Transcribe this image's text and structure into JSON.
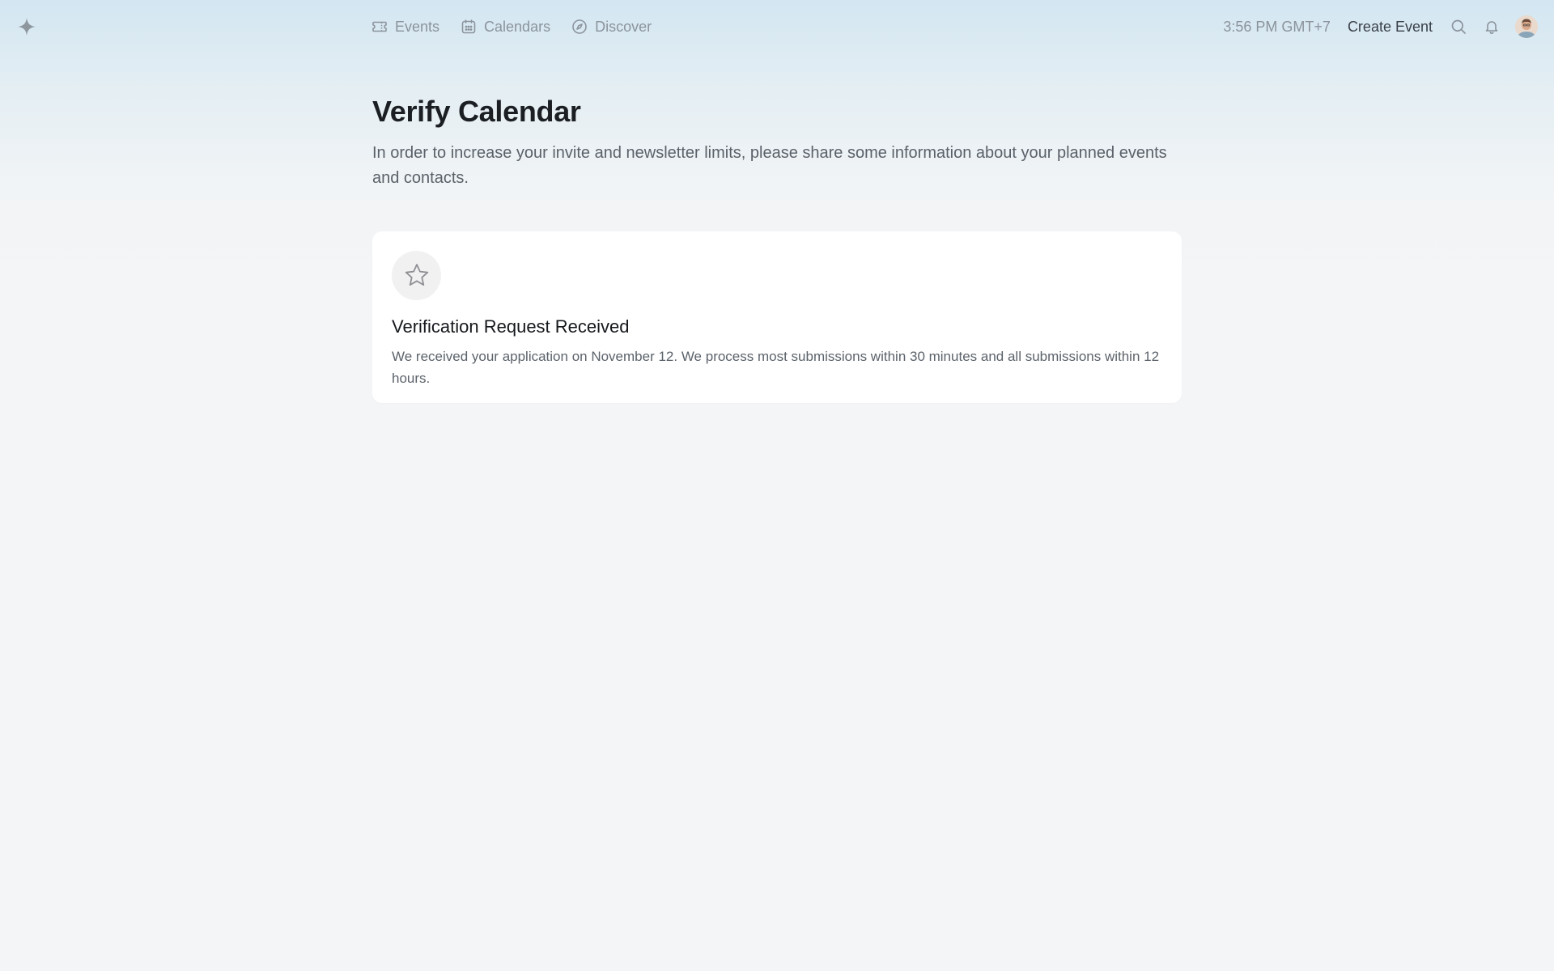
{
  "nav": {
    "logo_icon": "sparkle-icon",
    "items": [
      {
        "label": "Events",
        "icon": "ticket-icon"
      },
      {
        "label": "Calendars",
        "icon": "calendar-icon"
      },
      {
        "label": "Discover",
        "icon": "compass-icon"
      }
    ],
    "time": "3:56 PM GMT+7",
    "create_label": "Create Event",
    "search_icon": "search-icon",
    "bell_icon": "bell-icon"
  },
  "page": {
    "title": "Verify Calendar",
    "description": "In order to increase your invite and newsletter limits, please share some information about your planned events and contacts."
  },
  "card": {
    "icon": "star-icon",
    "title": "Verification Request Received",
    "text": "We received your application on November 12. We process most submissions within 30 minutes and all submissions within 12 hours."
  },
  "colors": {
    "muted": "#8b939c",
    "heading": "#1b1f24",
    "card_bg": "#ffffff",
    "page_bg": "#f4f5f7"
  }
}
